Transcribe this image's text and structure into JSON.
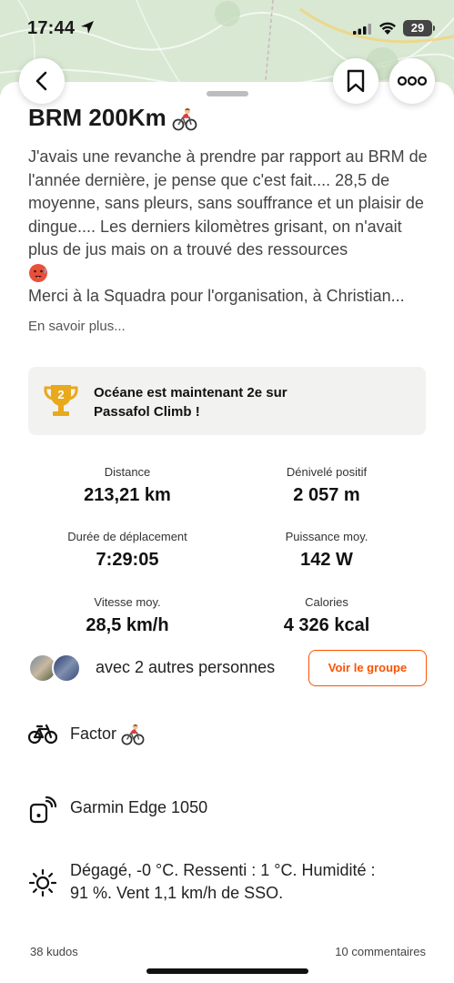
{
  "status_bar": {
    "time": "17:44",
    "battery": "29"
  },
  "activity": {
    "title": "BRM 200Km",
    "description_lines": [
      "J'avais une revanche à prendre par rapport au BRM de l'année dernière, je pense que c'est fait.... 28,5 de moyenne, sans pleurs, sans souffrance et un plaisir de dingue.... Les derniers kilomètres grisant, on n'avait plus de jus mais on a trouvé des ressources",
      "Merci à la Squadra pour l'organisation, à Christian..."
    ],
    "more_link": "En savoir plus..."
  },
  "achievement": {
    "text_line1": "Océane est maintenant 2e sur",
    "text_line2": "Passafol Climb !",
    "rank": "2"
  },
  "stats": {
    "distance_label": "Distance",
    "distance_value": "213,21 km",
    "elevation_label": "Dénivelé positif",
    "elevation_value": "2 057 m",
    "moving_time_label": "Durée de déplacement",
    "moving_time_value": "7:29:05",
    "power_label": "Puissance moy.",
    "power_value": "142 W",
    "speed_label": "Vitesse moy.",
    "speed_value": "28,5 km/h",
    "calories_label": "Calories",
    "calories_value": "4 326 kcal"
  },
  "group": {
    "text": "avec 2 autres personnes",
    "button_label": "Voir le groupe"
  },
  "gear": {
    "bike": "Factor",
    "device": "Garmin Edge 1050",
    "weather_line1": "Dégagé, -0  °C. Ressenti : 1  °C. Humidité :",
    "weather_line2": "91 %. Vent 1,1 km/h de SSO."
  },
  "footer": {
    "kudos": "38 kudos",
    "comments": "10 commentaires"
  },
  "colors": {
    "accent": "#fc5200",
    "trophy": "#e8a91d",
    "achievement_bg": "#f2f2f0"
  },
  "icons": {
    "back": "chevron-left-icon",
    "bookmark": "bookmark-icon",
    "more": "more-dots-icon",
    "trophy": "trophy-icon",
    "bike": "bicycle-icon",
    "device": "device-icon",
    "weather": "sun-icon"
  }
}
